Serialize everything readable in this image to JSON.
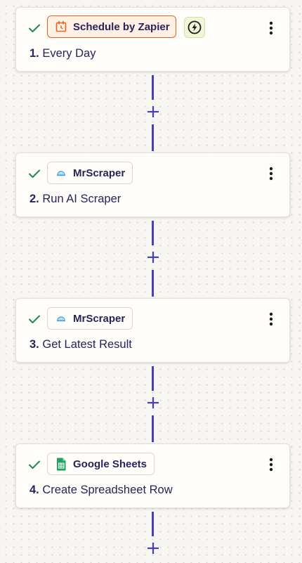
{
  "colors": {
    "accent_purple": "#4a3fb0",
    "text_primary": "#2b2358",
    "success_green": "#1f8a4c",
    "zapier_orange": "#e8621c",
    "instant_bg": "#f2f6d8",
    "mrscraper_blue": "#4aa3e8",
    "sheets_green": "#21a366",
    "canvas_bg": "#f7f6f2"
  },
  "steps": [
    {
      "number": "1.",
      "title": "Every Day",
      "app": "Schedule by Zapier",
      "app_icon": "calendar-clock-icon",
      "status": "complete",
      "is_trigger": true,
      "instant_badge_icon": "lightning-bolt-icon"
    },
    {
      "number": "2.",
      "title": "Run AI Scraper",
      "app": "MrScraper",
      "app_icon": "mrscraper-logo-icon",
      "status": "complete"
    },
    {
      "number": "3.",
      "title": "Get Latest Result",
      "app": "MrScraper",
      "app_icon": "mrscraper-logo-icon",
      "status": "complete"
    },
    {
      "number": "4.",
      "title": "Create Spreadsheet Row",
      "app": "Google Sheets",
      "app_icon": "google-sheets-icon",
      "status": "complete"
    }
  ],
  "icons": {
    "status": "checkmark-icon",
    "step_menu": "vertical-ellipsis-icon",
    "add_step": "plus-icon"
  }
}
